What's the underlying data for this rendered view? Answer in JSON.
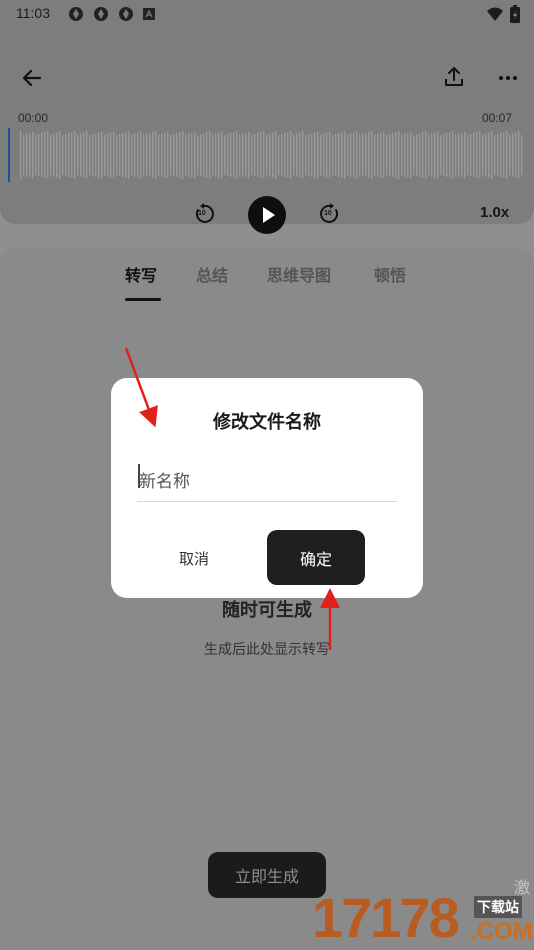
{
  "status_bar": {
    "time": "11:03"
  },
  "player": {
    "time_start": "00:00",
    "time_end": "00:07",
    "rewind_label": "10",
    "forward_label": "10",
    "speed": "1.0x"
  },
  "tabs": [
    {
      "label": "转写"
    },
    {
      "label": "总结"
    },
    {
      "label": "思维导图"
    },
    {
      "label": "顿悟"
    }
  ],
  "empty_state": {
    "title": "随时可生成",
    "subtitle": "生成后此处显示转写"
  },
  "generate_button": "立即生成",
  "dialog": {
    "title": "修改文件名称",
    "input_placeholder": "新名称",
    "cancel": "取消",
    "confirm": "确定"
  },
  "watermark": {
    "main": "17178",
    "download": "下载站",
    "domain": ".COM",
    "side": "激"
  },
  "colors": {
    "overlay": "#8f8f8f",
    "dialog_bg": "#ffffff",
    "primary_button": "#1f1f1f",
    "annotation_arrow": "#e0201a"
  }
}
